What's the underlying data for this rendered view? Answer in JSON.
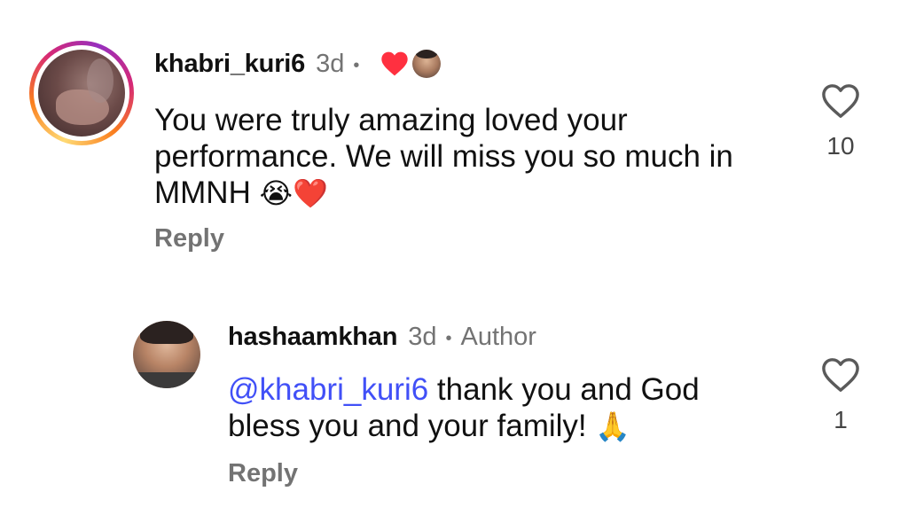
{
  "comments": [
    {
      "username": "khabri_kuri6",
      "time": "3d",
      "separator": "•",
      "text": "You were truly amazing loved your performance. We will miss you so much in MMNH",
      "emojis": "😭❤️",
      "reply_label": "Reply",
      "like_count": "10",
      "author_liked": true,
      "story_ring": true
    },
    {
      "username": "hashaamkhan",
      "time": "3d",
      "separator": "•",
      "badge": "Author",
      "mention": "@khabri_kuri6",
      "text": " thank you and God bless you and your family!",
      "emojis": "🙏",
      "reply_label": "Reply",
      "like_count": "1"
    }
  ],
  "colors": {
    "heart_red": "#ff3040",
    "mention_blue": "#4150f7",
    "muted_gray": "#737373"
  },
  "icons": [
    "heart-outline-icon",
    "heart-filled-icon"
  ]
}
